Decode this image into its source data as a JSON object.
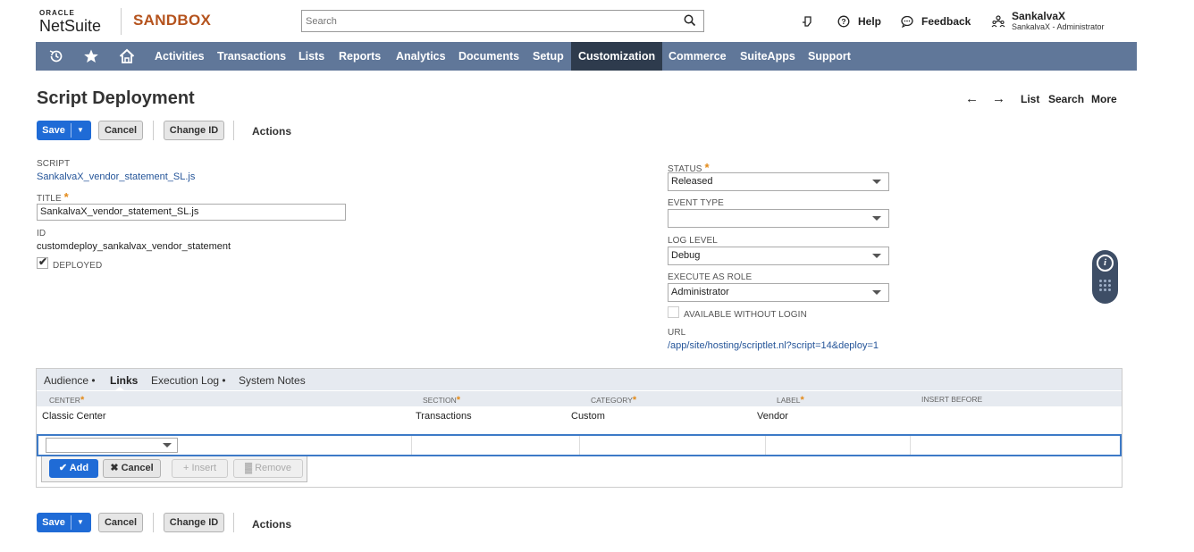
{
  "header": {
    "logo_top": "ORACLE",
    "logo_bottom": "NetSuite",
    "environment": "SANDBOX",
    "search_placeholder": "Search",
    "help": "Help",
    "feedback": "Feedback",
    "user_name": "SankalvaX",
    "user_role": "SankalvaX - Administrator"
  },
  "nav": {
    "items": [
      "Activities",
      "Transactions",
      "Lists",
      "Reports",
      "Analytics",
      "Documents",
      "Setup",
      "Customization",
      "Commerce",
      "SuiteApps",
      "Support"
    ],
    "active": "Customization"
  },
  "page": {
    "title": "Script Deployment",
    "pager": {
      "list": "List",
      "search": "Search",
      "more": "More"
    }
  },
  "toolbar": {
    "save": "Save",
    "cancel": "Cancel",
    "change_id": "Change ID",
    "actions": "Actions"
  },
  "form": {
    "script_label": "SCRIPT",
    "script_value": "SankalvaX_vendor_statement_SL.js",
    "title_label": "TITLE",
    "title_value": "SankalvaX_vendor_statement_SL.js",
    "id_label": "ID",
    "id_value": "customdeploy_sankalvax_vendor_statement",
    "deployed_label": "DEPLOYED",
    "deployed_checked": true,
    "status_label": "STATUS",
    "status_value": "Released",
    "event_type_label": "EVENT TYPE",
    "event_type_value": "",
    "log_level_label": "LOG LEVEL",
    "log_level_value": "Debug",
    "execute_as_role_label": "EXECUTE AS ROLE",
    "execute_as_role_value": "Administrator",
    "available_without_login_label": "AVAILABLE WITHOUT LOGIN",
    "available_without_login_checked": false,
    "url_label": "URL",
    "url_value": "/app/site/hosting/scriptlet.nl?script=14&deploy=1"
  },
  "subtabs": {
    "tabs": [
      "Audience •",
      "Links",
      "Execution Log •",
      "System Notes"
    ],
    "active": "Links"
  },
  "links_grid": {
    "columns": [
      "CENTER",
      "SECTION",
      "CATEGORY",
      "LABEL",
      "INSERT BEFORE"
    ],
    "rows": [
      {
        "center": "Classic Center",
        "section": "Transactions",
        "category": "Custom",
        "label": "Vendor",
        "insert_before": ""
      }
    ],
    "buttons": {
      "add": "Add",
      "cancel": "Cancel",
      "insert": "Insert",
      "remove": "Remove"
    }
  },
  "colors": {
    "nav_bg": "#607799",
    "nav_active": "#2e3b4d",
    "primary_button": "#1f6bd6",
    "sandbox_text": "#b5531d",
    "link": "#255599",
    "required": "#e38a18"
  }
}
